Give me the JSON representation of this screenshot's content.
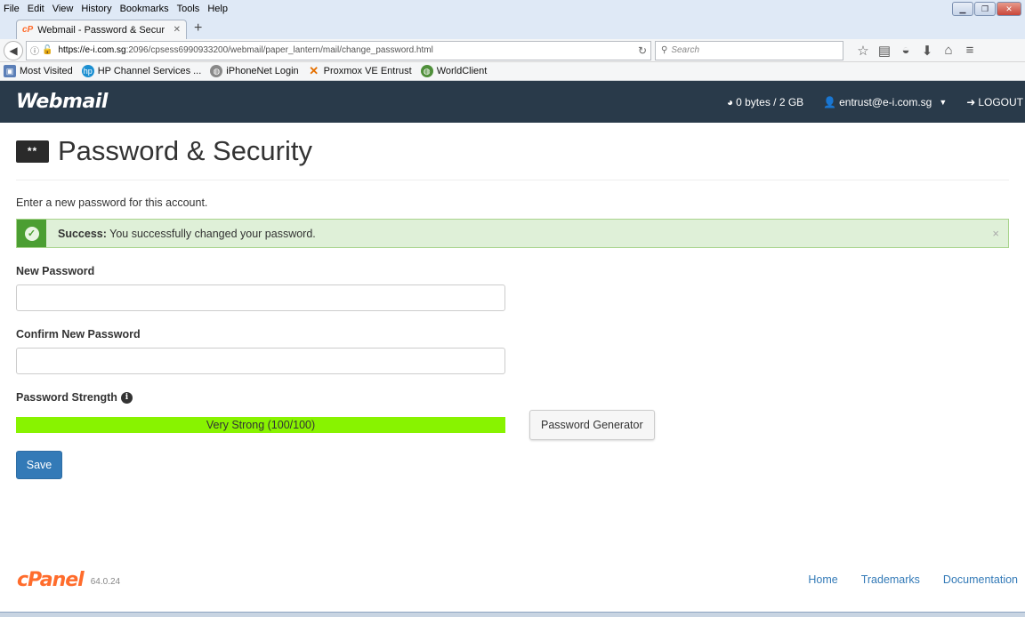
{
  "browser": {
    "menu": [
      "File",
      "Edit",
      "View",
      "History",
      "Bookmarks",
      "Tools",
      "Help"
    ],
    "tab": {
      "title": "Webmail - Password & Secur"
    },
    "url": {
      "host": "https://e-i.com.sg",
      "rest": ":2096/cpsess6990933200/webmail/paper_lantern/mail/change_password.html"
    },
    "search_placeholder": "Search",
    "bookmarks": [
      "Most Visited",
      "HP Channel Services ...",
      "iPhoneNet Login",
      "Proxmox VE Entrust",
      "WorldClient"
    ]
  },
  "app": {
    "brand": "Webmail",
    "quota": "0 bytes / 2 GB",
    "user": "entrust@e-i.com.sg",
    "logout": "LOGOUT"
  },
  "page": {
    "icon_text": "**",
    "title": "Password & Security",
    "intro": "Enter a new password for this account.",
    "alert": {
      "strong": "Success:",
      "text": " You successfully changed your password."
    },
    "new_password_label": "New Password",
    "confirm_password_label": "Confirm New Password",
    "strength_label": "Password Strength",
    "strength_text": "Very Strong (100/100)",
    "strength_value": 100,
    "generator_button": "Password Generator",
    "save_button": "Save"
  },
  "footer": {
    "logo": "cPanel",
    "version": "64.0.24",
    "links": [
      "Home",
      "Trademarks",
      "Documentation"
    ]
  },
  "colors": {
    "appbar": "#293a4a",
    "accent": "#337ab7",
    "success": "#4b9e32",
    "strength": "#88f300",
    "cpanel": "#ff6c2c"
  }
}
